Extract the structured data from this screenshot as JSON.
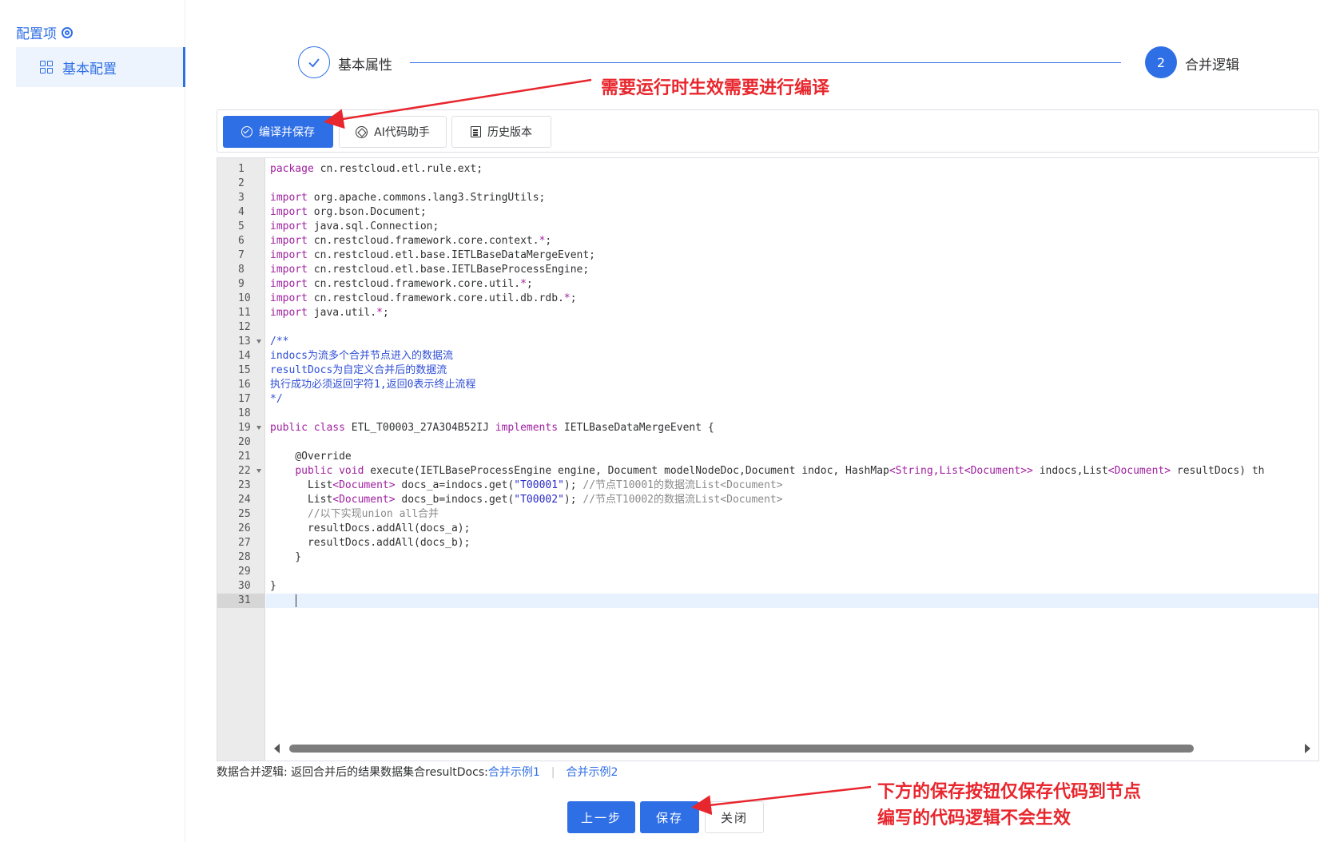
{
  "sidebar": {
    "title": "配置项",
    "item_label": "基本配置"
  },
  "steps": {
    "step1_label": "基本属性",
    "step2_number": "2",
    "step2_label": "合并逻辑"
  },
  "annotations": {
    "top": "需要运行时生效需要进行编译",
    "bottom_line1": "下方的保存按钮仅保存代码到节点",
    "bottom_line2": "编写的代码逻辑不会生效"
  },
  "toolbar": {
    "compile_save_label": "编译并保存",
    "ai_assistant_label": "AI代码助手",
    "history_label": "历史版本"
  },
  "editor": {
    "line_numbers": [
      "1",
      "2",
      "3",
      "4",
      "5",
      "6",
      "7",
      "8",
      "9",
      "10",
      "11",
      "12",
      "13",
      "14",
      "15",
      "16",
      "17",
      "18",
      "19",
      "20",
      "21",
      "22",
      "23",
      "24",
      "25",
      "26",
      "27",
      "28",
      "29",
      "30",
      "31"
    ],
    "folded_lines": [
      13,
      19,
      22
    ],
    "active_line": 31,
    "lines": [
      [
        {
          "t": "package",
          "c": "kw"
        },
        {
          "t": " cn.restcloud.etl.rule.ext;",
          "c": "p"
        }
      ],
      [],
      [
        {
          "t": "import",
          "c": "kw"
        },
        {
          "t": " org.apache.commons.lang3.StringUtils;",
          "c": "p"
        }
      ],
      [
        {
          "t": "import",
          "c": "kw"
        },
        {
          "t": " org.bson.Document;",
          "c": "p"
        }
      ],
      [
        {
          "t": "import",
          "c": "kw"
        },
        {
          "t": " java.sql.Connection;",
          "c": "p"
        }
      ],
      [
        {
          "t": "import",
          "c": "kw"
        },
        {
          "t": " cn.restcloud.framework.core.context.",
          "c": "p"
        },
        {
          "t": "*",
          "c": "kw"
        },
        {
          "t": ";",
          "c": "p"
        }
      ],
      [
        {
          "t": "import",
          "c": "kw"
        },
        {
          "t": " cn.restcloud.etl.base.IETLBaseDataMergeEvent;",
          "c": "p"
        }
      ],
      [
        {
          "t": "import",
          "c": "kw"
        },
        {
          "t": " cn.restcloud.etl.base.IETLBaseProcessEngine;",
          "c": "p"
        }
      ],
      [
        {
          "t": "import",
          "c": "kw"
        },
        {
          "t": " cn.restcloud.framework.core.util.",
          "c": "p"
        },
        {
          "t": "*",
          "c": "kw"
        },
        {
          "t": ";",
          "c": "p"
        }
      ],
      [
        {
          "t": "import",
          "c": "kw"
        },
        {
          "t": " cn.restcloud.framework.core.util.db.rdb.",
          "c": "p"
        },
        {
          "t": "*",
          "c": "kw"
        },
        {
          "t": ";",
          "c": "p"
        }
      ],
      [
        {
          "t": "import",
          "c": "kw"
        },
        {
          "t": " java.util.",
          "c": "p"
        },
        {
          "t": "*",
          "c": "kw"
        },
        {
          "t": ";",
          "c": "p"
        }
      ],
      [],
      [
        {
          "t": "/**",
          "c": "cm"
        }
      ],
      [
        {
          "t": "indocs为流多个合并节点进入的数据流",
          "c": "cm"
        }
      ],
      [
        {
          "t": "resultDocs为自定义合并后的数据流",
          "c": "cm"
        }
      ],
      [
        {
          "t": "执行成功必须返回字符1,返回0表示终止流程",
          "c": "cm"
        }
      ],
      [
        {
          "t": "*/",
          "c": "cm"
        }
      ],
      [],
      [
        {
          "t": "public class",
          "c": "kw"
        },
        {
          "t": " ETL_T00003_27A3O4B52IJ ",
          "c": "p"
        },
        {
          "t": "implements",
          "c": "kw"
        },
        {
          "t": " IETLBaseDataMergeEvent {",
          "c": "p"
        }
      ],
      [],
      [
        {
          "t": "    @Override",
          "c": "p"
        }
      ],
      [
        {
          "t": "    ",
          "c": "p"
        },
        {
          "t": "public void",
          "c": "kw"
        },
        {
          "t": " execute(IETLBaseProcessEngine engine, Document modelNodeDoc,Document indoc, HashMap",
          "c": "p"
        },
        {
          "t": "<String,List<Document>>",
          "c": "kw"
        },
        {
          "t": " indocs,List",
          "c": "p"
        },
        {
          "t": "<Document>",
          "c": "kw"
        },
        {
          "t": " resultDocs) th",
          "c": "p"
        }
      ],
      [
        {
          "t": "      List",
          "c": "p"
        },
        {
          "t": "<Document>",
          "c": "kw"
        },
        {
          "t": " docs_a=indocs.get(",
          "c": "p"
        },
        {
          "t": "\"T00001\"",
          "c": "str"
        },
        {
          "t": "); ",
          "c": "p"
        },
        {
          "t": "//节点T10001的数据流List<Document>",
          "c": "cm2"
        }
      ],
      [
        {
          "t": "      List",
          "c": "p"
        },
        {
          "t": "<Document>",
          "c": "kw"
        },
        {
          "t": " docs_b=indocs.get(",
          "c": "p"
        },
        {
          "t": "\"T00002\"",
          "c": "str"
        },
        {
          "t": "); ",
          "c": "p"
        },
        {
          "t": "//节点T10002的数据流List<Document>",
          "c": "cm2"
        }
      ],
      [
        {
          "t": "      //以下实现union all合并",
          "c": "cm2"
        }
      ],
      [
        {
          "t": "      resultDocs.addAll(docs_a);",
          "c": "p"
        }
      ],
      [
        {
          "t": "      resultDocs.addAll(docs_b);",
          "c": "p"
        }
      ],
      [
        {
          "t": "    }",
          "c": "p"
        }
      ],
      [],
      [
        {
          "t": "}",
          "c": "p"
        }
      ],
      []
    ]
  },
  "footer": {
    "description": "数据合并逻辑: 返回合并后的结果数据集合resultDocs:",
    "example1": "合并示例1",
    "example2": "合并示例2",
    "prev_label": "上一步",
    "save_label": "保存",
    "close_label": "关闭"
  },
  "colors": {
    "primary": "#2f6fe6",
    "annotation": "#e8262d",
    "keyword": "#a020a0",
    "comment": "#2f4fd6",
    "comment2": "#8a8a8a",
    "string": "#2a2ac8"
  },
  "icons": {
    "sidebar_title": "target-icon",
    "sidebar_item": "grid-icon",
    "step1": "check-icon",
    "compile": "check-circle-icon",
    "ai": "ai-icon",
    "history": "history-icon"
  }
}
